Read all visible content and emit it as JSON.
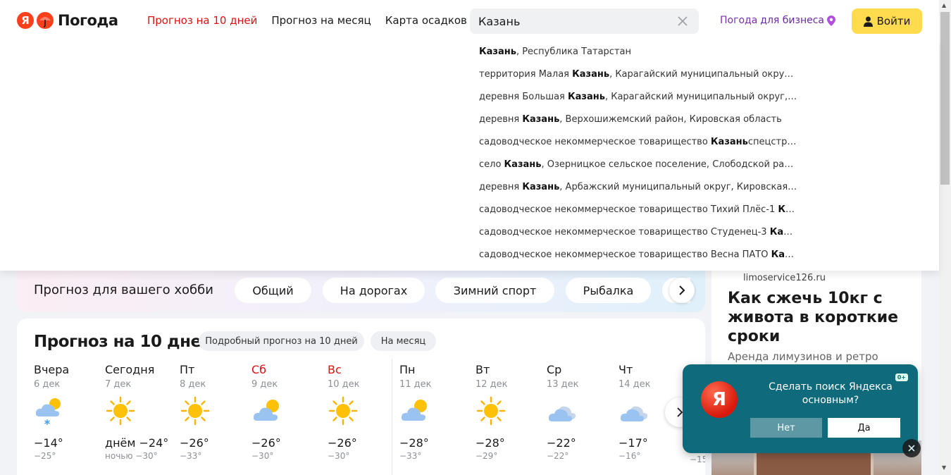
{
  "header": {
    "logo_letter": "Я",
    "logo_text": "Погода",
    "nav": [
      {
        "label": "Прогноз на 10 дней",
        "active": true
      },
      {
        "label": "Прогноз на месяц",
        "active": false
      },
      {
        "label": "Карта осадков",
        "active": false
      }
    ],
    "search_value": "Казань",
    "business_prefix": "Погода ",
    "business_suffix": "для бизнеса",
    "login_label": "Войти"
  },
  "suggest": [
    {
      "pre": "",
      "bold": "Казань",
      "post": ", Республика Татарстан"
    },
    {
      "pre": "территория Малая ",
      "bold": "Казань",
      "post": ", Карагайский муниципальный округ, Пе..."
    },
    {
      "pre": "деревня Большая ",
      "bold": "Казань",
      "post": ", Карагайский муниципальный округ, Пер..."
    },
    {
      "pre": "деревня ",
      "bold": "Казань",
      "post": ", Верхошижемский район, Кировская область"
    },
    {
      "pre": "садоводческое некоммерческое товарищество ",
      "bold": "Казань",
      "post": "спецстрой, ..."
    },
    {
      "pre": "село ",
      "bold": "Казань",
      "post": ", Озерницкое сельское поселение, Слободской район, ..."
    },
    {
      "pre": "деревня ",
      "bold": "Казань",
      "post": ", Арбажский муниципальный округ, Кировская обл..."
    },
    {
      "pre": "садоводческое некоммерческое товарищество Тихий Плёс-1 ",
      "bold": "Каза...",
      "post": ""
    },
    {
      "pre": "садоводческое некоммерческое товарищество Студенец-3 ",
      "bold": "Казань...",
      "post": ""
    },
    {
      "pre": "садоводческое некоммерческое товарищество Весна ПАТО ",
      "bold": "Казань...",
      "post": ""
    }
  ],
  "hobby": {
    "title": "Прогноз для вашего хобби",
    "chips": [
      "Общий",
      "На дорогах",
      "Зимний спорт",
      "Рыбалка"
    ]
  },
  "forecast": {
    "title": "Прогноз на 10 дней",
    "btn_detailed": "Подробный прогноз на 10 дней",
    "btn_month": "На месяц",
    "days": [
      {
        "name": "Вчера",
        "date": "6 дек",
        "icon": "cloud-snow-icon",
        "t": "−14°",
        "tn": "−25°",
        "weekend": false
      },
      {
        "name": "Сегодня",
        "date": "7 дек",
        "icon": "sun-icon",
        "t": "днём −24°",
        "tn": "ночью −30°",
        "weekend": false
      },
      {
        "name": "Пт",
        "date": "8 дек",
        "icon": "sun-icon",
        "t": "−26°",
        "tn": "−33°",
        "weekend": false
      },
      {
        "name": "Сб",
        "date": "9 дек",
        "icon": "partly-cloudy-icon",
        "t": "−26°",
        "tn": "−30°",
        "weekend": true
      },
      {
        "name": "Вс",
        "date": "10 дек",
        "icon": "sun-icon",
        "t": "−26°",
        "tn": "−30°",
        "weekend": true
      },
      {
        "name": "Пн",
        "date": "11 дек",
        "icon": "partly-cloudy-icon",
        "t": "−28°",
        "tn": "−33°",
        "weekend": false
      },
      {
        "name": "Вт",
        "date": "12 дек",
        "icon": "sun-icon",
        "t": "−28°",
        "tn": "−29°",
        "weekend": false
      },
      {
        "name": "Ср",
        "date": "13 дек",
        "icon": "cloudy-icon",
        "t": "−22°",
        "tn": "−22°",
        "weekend": false
      },
      {
        "name": "Чт",
        "date": "14 дек",
        "icon": "cloudy-icon",
        "t": "−17°",
        "tn": "−16°",
        "weekend": false
      }
    ],
    "partial_tn": "−15"
  },
  "ad": {
    "domain": "limoservice126.ru",
    "headline": "Как сжечь 10кг с живота в короткие сроки",
    "text": "Аренда лимузинов и ретро"
  },
  "popup": {
    "text": "Сделать поиск Яндекса основным?",
    "age": "0+",
    "no": "Нет",
    "yes": "Да",
    "logo_letter": "Я"
  },
  "colors": {
    "accent_red": "#dd1111",
    "login_yellow": "#ffdb4d",
    "business_purple": "#7b2fb0",
    "popup_teal": "#0f6b7c"
  }
}
